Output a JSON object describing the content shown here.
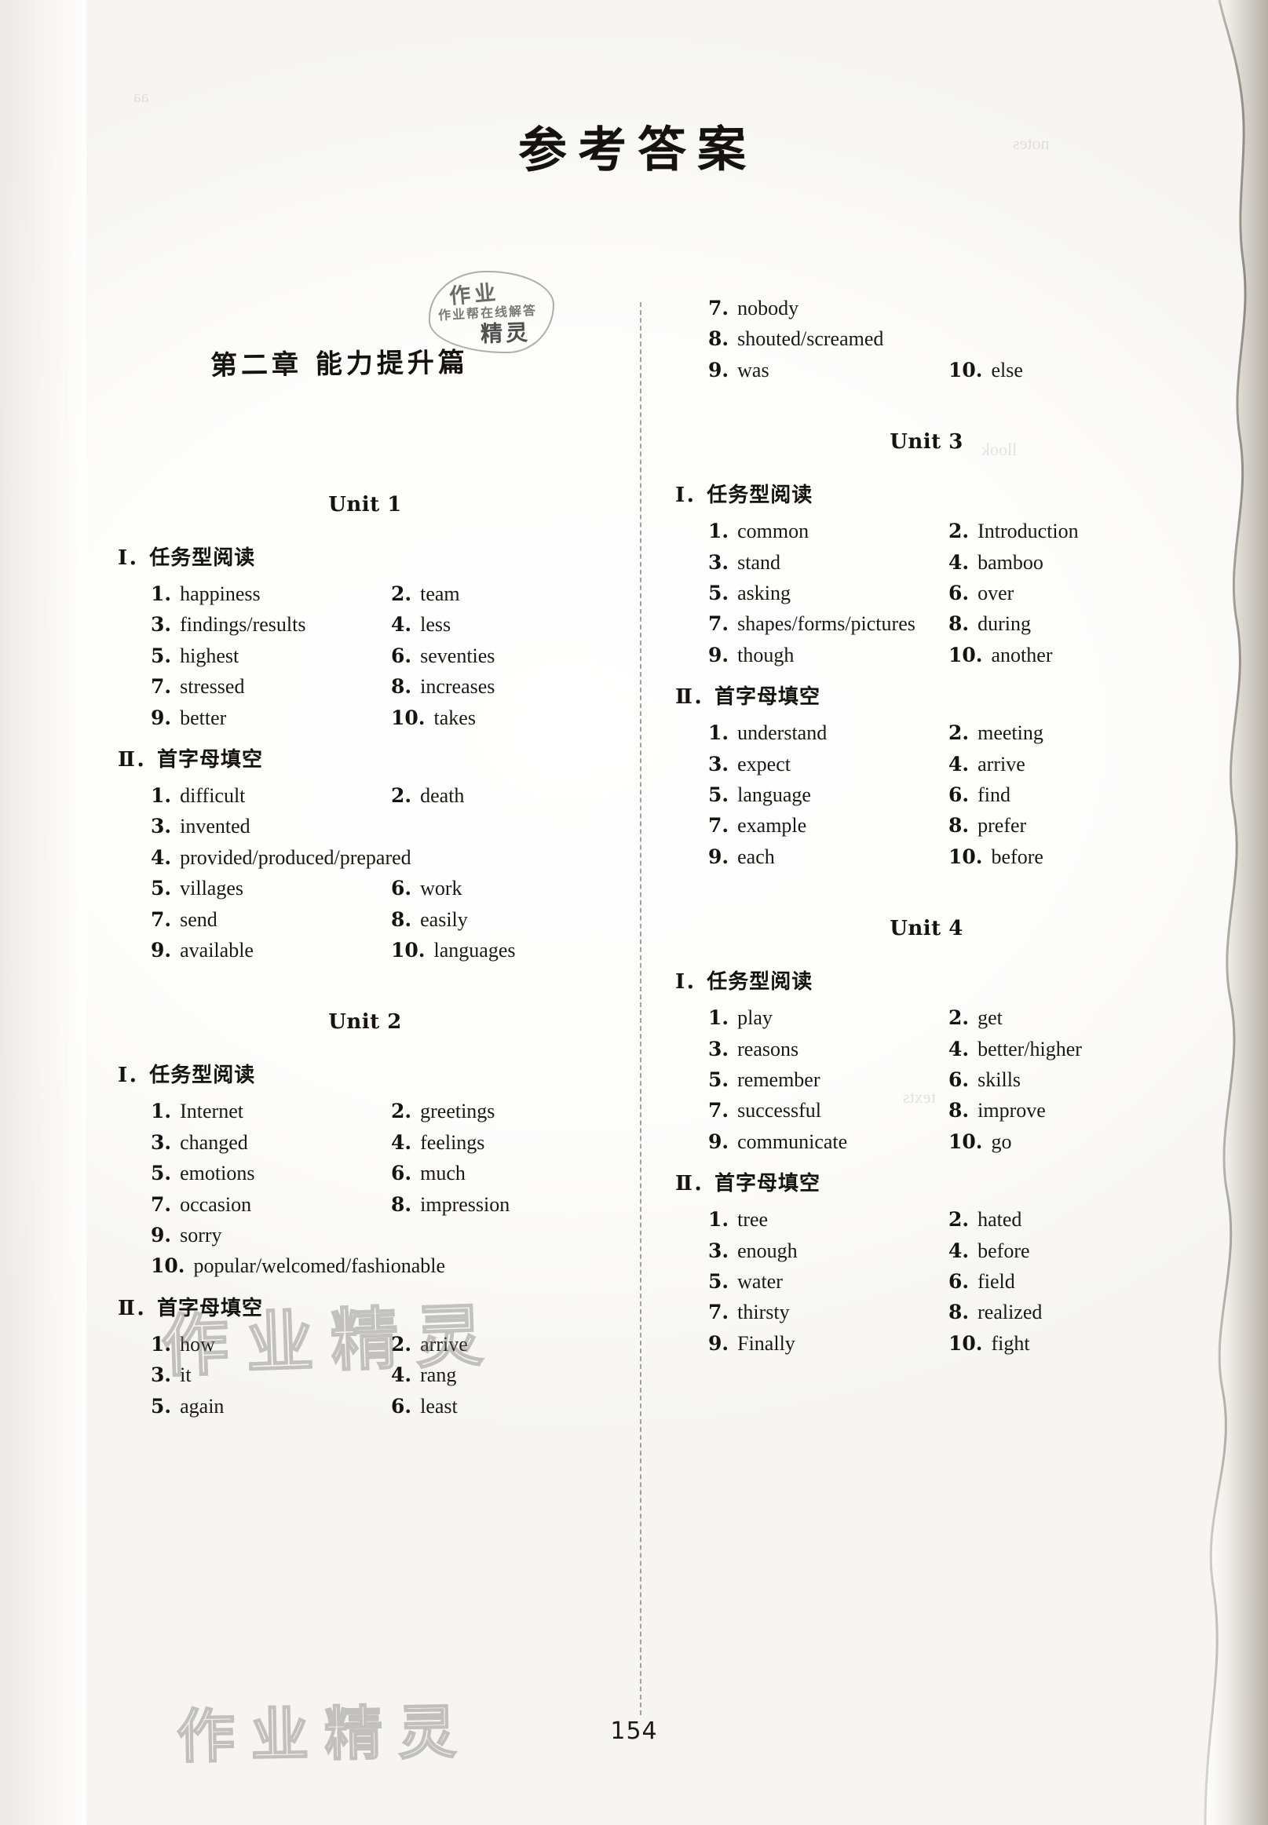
{
  "page": {
    "title": "参考答案",
    "chapter": "第二章  能力提升篇",
    "page_number": "154",
    "stamp": {
      "line1": "作业",
      "line2": "作业帮在线解答",
      "line3": "精灵"
    },
    "watermark": "作业精灵"
  },
  "columns": {
    "left": [
      {
        "type": "continuation",
        "rows": []
      },
      {
        "type": "unit",
        "unit_label": "Unit 1",
        "sections": [
          {
            "numeral": "Ⅰ",
            "title": "任务型阅读",
            "rows": [
              {
                "a": {
                  "n": "1",
                  "t": "happiness"
                },
                "b": {
                  "n": "2",
                  "t": "team"
                }
              },
              {
                "a": {
                  "n": "3",
                  "t": "findings/results"
                },
                "b": {
                  "n": "4",
                  "t": "less"
                }
              },
              {
                "a": {
                  "n": "5",
                  "t": "highest"
                },
                "b": {
                  "n": "6",
                  "t": "seventies"
                }
              },
              {
                "a": {
                  "n": "7",
                  "t": "stressed"
                },
                "b": {
                  "n": "8",
                  "t": "increases"
                }
              },
              {
                "a": {
                  "n": "9",
                  "t": "better"
                },
                "b": {
                  "n": "10",
                  "t": "takes"
                }
              }
            ]
          },
          {
            "numeral": "Ⅱ",
            "title": "首字母填空",
            "rows": [
              {
                "a": {
                  "n": "1",
                  "t": "difficult"
                },
                "b": {
                  "n": "2",
                  "t": "death"
                }
              },
              {
                "a": {
                  "n": "3",
                  "t": "invented"
                },
                "b": null
              },
              {
                "a": {
                  "n": "4",
                  "t": "provided/produced/prepared"
                },
                "b": null
              },
              {
                "a": {
                  "n": "5",
                  "t": "villages"
                },
                "b": {
                  "n": "6",
                  "t": "work"
                }
              },
              {
                "a": {
                  "n": "7",
                  "t": "send"
                },
                "b": {
                  "n": "8",
                  "t": "easily"
                }
              },
              {
                "a": {
                  "n": "9",
                  "t": "available"
                },
                "b": {
                  "n": "10",
                  "t": "languages"
                }
              }
            ]
          }
        ]
      },
      {
        "type": "unit",
        "unit_label": "Unit 2",
        "sections": [
          {
            "numeral": "Ⅰ",
            "title": "任务型阅读",
            "rows": [
              {
                "a": {
                  "n": "1",
                  "t": "Internet"
                },
                "b": {
                  "n": "2",
                  "t": "greetings"
                }
              },
              {
                "a": {
                  "n": "3",
                  "t": "changed"
                },
                "b": {
                  "n": "4",
                  "t": "feelings"
                }
              },
              {
                "a": {
                  "n": "5",
                  "t": "emotions"
                },
                "b": {
                  "n": "6",
                  "t": "much"
                }
              },
              {
                "a": {
                  "n": "7",
                  "t": "occasion"
                },
                "b": {
                  "n": "8",
                  "t": "impression"
                }
              },
              {
                "a": {
                  "n": "9",
                  "t": "sorry"
                },
                "b": null
              },
              {
                "a": {
                  "n": "10",
                  "t": "popular/welcomed/fashionable"
                },
                "b": null
              }
            ]
          },
          {
            "numeral": "Ⅱ",
            "title": "首字母填空",
            "rows": [
              {
                "a": {
                  "n": "1",
                  "t": "how"
                },
                "b": {
                  "n": "2",
                  "t": "arrive"
                }
              },
              {
                "a": {
                  "n": "3",
                  "t": "it"
                },
                "b": {
                  "n": "4",
                  "t": "rang"
                }
              },
              {
                "a": {
                  "n": "5",
                  "t": "again"
                },
                "b": {
                  "n": "6",
                  "t": "least"
                }
              }
            ]
          }
        ]
      }
    ],
    "right": [
      {
        "type": "continuation",
        "rows": [
          {
            "a": {
              "n": "7",
              "t": "nobody"
            },
            "b": null
          },
          {
            "a": {
              "n": "8",
              "t": "shouted/screamed"
            },
            "b": null
          },
          {
            "a": {
              "n": "9",
              "t": "was"
            },
            "b": {
              "n": "10",
              "t": "else"
            }
          }
        ]
      },
      {
        "type": "unit",
        "unit_label": "Unit 3",
        "sections": [
          {
            "numeral": "Ⅰ",
            "title": "任务型阅读",
            "rows": [
              {
                "a": {
                  "n": "1",
                  "t": "common"
                },
                "b": {
                  "n": "2",
                  "t": "Introduction"
                }
              },
              {
                "a": {
                  "n": "3",
                  "t": "stand"
                },
                "b": {
                  "n": "4",
                  "t": "bamboo"
                }
              },
              {
                "a": {
                  "n": "5",
                  "t": "asking"
                },
                "b": {
                  "n": "6",
                  "t": "over"
                }
              },
              {
                "a": {
                  "n": "7",
                  "t": "shapes/forms/pictures"
                },
                "b": {
                  "n": "8",
                  "t": "during"
                }
              },
              {
                "a": {
                  "n": "9",
                  "t": "though"
                },
                "b": {
                  "n": "10",
                  "t": "another"
                }
              }
            ]
          },
          {
            "numeral": "Ⅱ",
            "title": "首字母填空",
            "rows": [
              {
                "a": {
                  "n": "1",
                  "t": "understand"
                },
                "b": {
                  "n": "2",
                  "t": "meeting"
                }
              },
              {
                "a": {
                  "n": "3",
                  "t": "expect"
                },
                "b": {
                  "n": "4",
                  "t": "arrive"
                }
              },
              {
                "a": {
                  "n": "5",
                  "t": "language"
                },
                "b": {
                  "n": "6",
                  "t": "find"
                }
              },
              {
                "a": {
                  "n": "7",
                  "t": "example"
                },
                "b": {
                  "n": "8",
                  "t": "prefer"
                }
              },
              {
                "a": {
                  "n": "9",
                  "t": "each"
                },
                "b": {
                  "n": "10",
                  "t": "before"
                }
              }
            ]
          }
        ]
      },
      {
        "type": "unit",
        "unit_label": "Unit 4",
        "sections": [
          {
            "numeral": "Ⅰ",
            "title": "任务型阅读",
            "rows": [
              {
                "a": {
                  "n": "1",
                  "t": "play"
                },
                "b": {
                  "n": "2",
                  "t": "get"
                }
              },
              {
                "a": {
                  "n": "3",
                  "t": "reasons"
                },
                "b": {
                  "n": "4",
                  "t": "better/higher"
                }
              },
              {
                "a": {
                  "n": "5",
                  "t": "remember"
                },
                "b": {
                  "n": "6",
                  "t": "skills"
                }
              },
              {
                "a": {
                  "n": "7",
                  "t": "successful"
                },
                "b": {
                  "n": "8",
                  "t": "improve"
                }
              },
              {
                "a": {
                  "n": "9",
                  "t": "communicate"
                },
                "b": {
                  "n": "10",
                  "t": "go"
                }
              }
            ]
          },
          {
            "numeral": "Ⅱ",
            "title": "首字母填空",
            "rows": [
              {
                "a": {
                  "n": "1",
                  "t": "tree"
                },
                "b": {
                  "n": "2",
                  "t": "hated"
                }
              },
              {
                "a": {
                  "n": "3",
                  "t": "enough"
                },
                "b": {
                  "n": "4",
                  "t": "before"
                }
              },
              {
                "a": {
                  "n": "5",
                  "t": "water"
                },
                "b": {
                  "n": "6",
                  "t": "field"
                }
              },
              {
                "a": {
                  "n": "7",
                  "t": "thirsty"
                },
                "b": {
                  "n": "8",
                  "t": "realized"
                }
              },
              {
                "a": {
                  "n": "9",
                  "t": "Finally"
                },
                "b": {
                  "n": "10",
                  "t": "fight"
                }
              }
            ]
          }
        ]
      }
    ]
  }
}
